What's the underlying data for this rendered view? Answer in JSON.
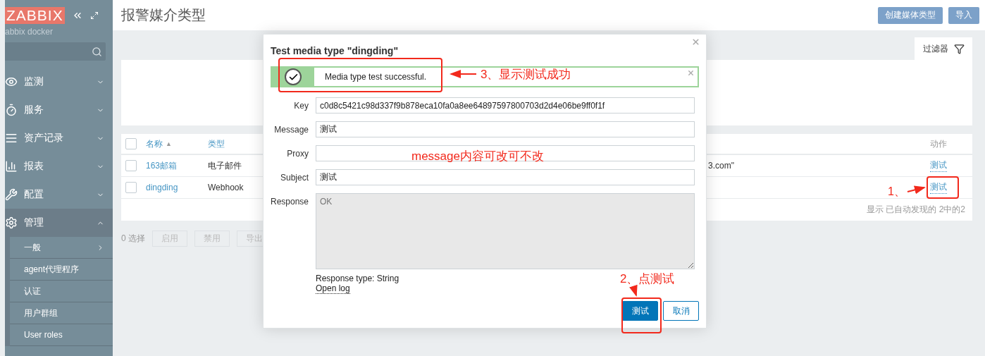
{
  "sidebar": {
    "logo": "ZABBIX",
    "server": "abbix docker",
    "menu": [
      {
        "label": "监测",
        "expanded": false
      },
      {
        "label": "服务",
        "expanded": false
      },
      {
        "label": "资产记录",
        "expanded": false
      },
      {
        "label": "报表",
        "expanded": false
      },
      {
        "label": "配置",
        "expanded": false
      },
      {
        "label": "管理",
        "expanded": true,
        "children": [
          {
            "label": "一般",
            "submenu": true
          },
          {
            "label": "agent代理程序",
            "submenu": false
          },
          {
            "label": "认证",
            "submenu": false
          },
          {
            "label": "用户群组",
            "submenu": false
          },
          {
            "label": "User roles",
            "submenu": false
          }
        ]
      }
    ]
  },
  "header": {
    "title": "报警媒介类型",
    "buttons": [
      "创建媒体类型",
      "导入"
    ]
  },
  "filter": {
    "tab": "过滤器"
  },
  "table": {
    "all_checked": false,
    "columns": [
      {
        "label": "名称",
        "sort_marker": "▲"
      },
      {
        "label": "类型"
      },
      {
        "label": "动作"
      }
    ],
    "rows": [
      {
        "checked": false,
        "name": "163邮箱",
        "type": "电子邮件",
        "column_4": "3.com\"",
        "action": "测试"
      },
      {
        "checked": false,
        "name": "dingding",
        "type": "Webhook",
        "action": "测试"
      }
    ],
    "footer": "显示 已自动发现的 2中的2"
  },
  "selection": {
    "count": "0 选择",
    "buttons": [
      {
        "label": "启用",
        "disabled": true
      },
      {
        "label": "禁用",
        "disabled": true
      },
      {
        "label": "导出",
        "disabled": true
      }
    ]
  },
  "dialog": {
    "title": "Test media type \"dingding\"",
    "message": "Media type test successful.",
    "fields": [
      {
        "label": "Key",
        "value": "c0d8c5421c98d337f9b878eca10fa0a8ee64897597800703d2d4e06be9ff0f1f"
      },
      {
        "label": "Message",
        "value": "测试"
      },
      {
        "label": "Proxy"
      },
      {
        "label": "Subject",
        "value": "测试"
      }
    ],
    "response": {
      "label": "Response",
      "placeholder": "OK"
    },
    "response_type": "Response type: String",
    "open_log": "Open log",
    "buttons": [
      {
        "label": "测试",
        "primary": true
      },
      {
        "label": "取消",
        "primary": false
      }
    ]
  },
  "annotations": [
    "3、显示测试成功",
    "message内容可改可不改",
    "2、点测试",
    "1、"
  ]
}
